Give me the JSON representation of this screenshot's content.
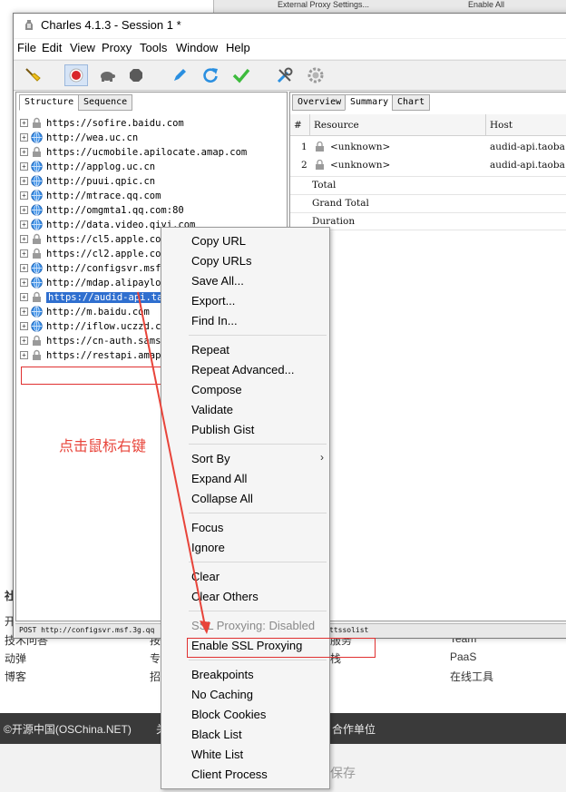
{
  "window": {
    "title": "Charles 4.1.3 - Session 1 *"
  },
  "menubar": [
    "File",
    "Edit",
    "View",
    "Proxy",
    "Tools",
    "Window",
    "Help"
  ],
  "toolbar": {
    "buttons": [
      "broom-icon",
      "record-icon",
      "throttle-turtle-icon",
      "breakpoint-hexagon-icon",
      "compose-pen-icon",
      "repeat-icon",
      "validate-check-icon",
      "tools-icon",
      "settings-gear-icon"
    ]
  },
  "left_pane": {
    "tabs": [
      "Structure",
      "Sequence"
    ],
    "selected_tab": "Structure",
    "tree": [
      {
        "label": "https://sofire.baidu.com",
        "locked": true
      },
      {
        "label": "http://wea.uc.cn",
        "locked": false
      },
      {
        "label": "https://ucmobile.apilocate.amap.com",
        "locked": true
      },
      {
        "label": "http://applog.uc.cn",
        "locked": false
      },
      {
        "label": "http://puui.qpic.cn",
        "locked": false
      },
      {
        "label": "http://mtrace.qq.com",
        "locked": false
      },
      {
        "label": "http://omgmta1.qq.com:80",
        "locked": false
      },
      {
        "label": "http://data.video.qiyi.com",
        "locked": false
      },
      {
        "label": "https://cl5.apple.co",
        "locked": true
      },
      {
        "label": "https://cl2.apple.co",
        "locked": true
      },
      {
        "label": "http://configsvr.msf",
        "locked": false
      },
      {
        "label": "http://mdap.alipaylo",
        "locked": false
      },
      {
        "label": "https://audid-api.ta",
        "locked": true,
        "selected": true
      },
      {
        "label": "http://m.baidu.com",
        "locked": false
      },
      {
        "label": "http://iflow.uczzd.c",
        "locked": false
      },
      {
        "label": "https://cn-auth.sams",
        "locked": true
      },
      {
        "label": "https://restapi.amap",
        "locked": true
      }
    ]
  },
  "right_pane": {
    "tabs": [
      "Overview",
      "Summary",
      "Chart"
    ],
    "selected_tab": "Summary",
    "columns": [
      "#",
      "Resource",
      "Host"
    ],
    "rows": [
      {
        "num": "1",
        "resource": "<unknown>",
        "host": "audid-api.taoba"
      },
      {
        "num": "2",
        "resource": "<unknown>",
        "host": "audid-api.taoba"
      }
    ],
    "summary": [
      "Total",
      "Grand Total",
      "Duration"
    ]
  },
  "statusbar": {
    "text": "POST http://configsvr.msf.3g.qq",
    "right": "ttssolist"
  },
  "annotation": "点击鼠标右键",
  "context_menu": {
    "groups": [
      [
        "Copy URL",
        "Copy URLs",
        "Save All...",
        "Export...",
        "Find In..."
      ],
      [
        "Repeat",
        "Repeat Advanced...",
        "Compose",
        "Validate",
        "Publish Gist"
      ],
      [
        "Sort By",
        "Expand All",
        "Collapse All"
      ],
      [
        "Focus",
        "Ignore"
      ],
      [
        "Clear",
        "Clear Others"
      ],
      [
        "SSL Proxying: Disabled",
        "Enable SSL Proxying"
      ],
      [
        "Breakpoints",
        "No Caching",
        "Block Cookies",
        "Black List",
        "White List",
        "Client Process"
      ]
    ]
  },
  "background_page": {
    "topstrip": [
      "External Proxy Settings...",
      "Enable All"
    ],
    "left_col": [
      "社",
      "开",
      "技术问答",
      "动弹",
      "博客"
    ],
    "mid_col": [
      "按",
      "专",
      "招"
    ],
    "right_col_a": [
      "服务",
      "栈"
    ],
    "right_col_b": [
      "Team",
      "PaaS",
      "在线工具"
    ],
    "footer": [
      "©开源中国(OSChina.NET)",
      "关",
      "合作单位"
    ],
    "bottom": "保存"
  },
  "colors": {
    "selection": "#2f6fcf",
    "annotation_red": "#e8443a",
    "record_red": "#d9262b",
    "repeat_blue": "#2a8fe0",
    "check_green": "#3dbb3d"
  }
}
